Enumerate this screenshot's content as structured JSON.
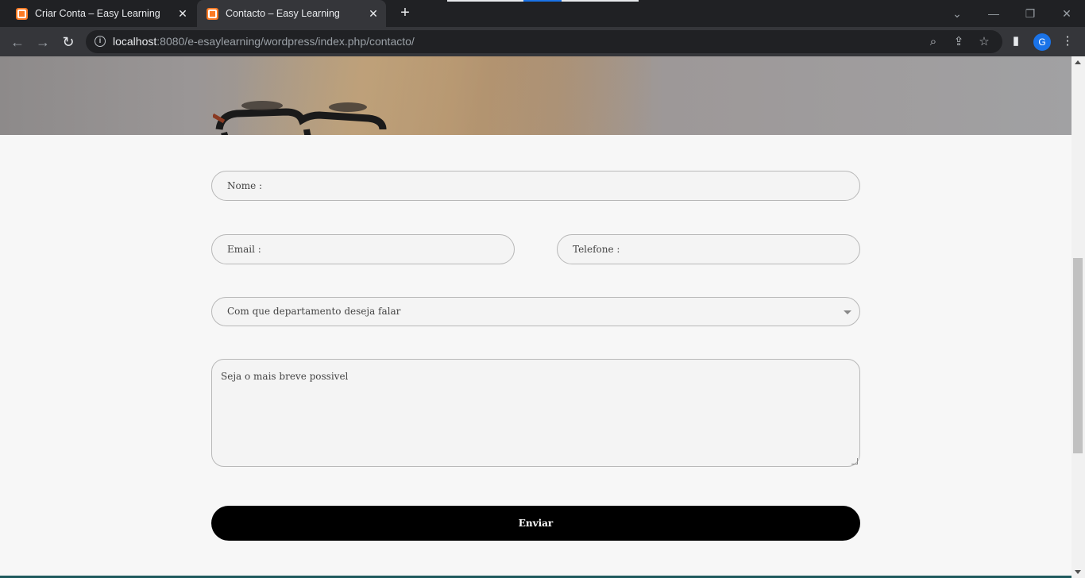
{
  "browser": {
    "tabs": [
      {
        "title": "Criar Conta – Easy Learning",
        "active": false,
        "favicon": "xampp-icon"
      },
      {
        "title": "Contacto – Easy Learning",
        "active": true,
        "favicon": "xampp-icon"
      }
    ],
    "new_tab_icon": "plus-icon",
    "url_host": "localhost",
    "url_rest": ":8080/e-esaylearning/wordpress/index.php/contacto/",
    "profile_initial": "G",
    "colors": {
      "frame": "#202124",
      "toolbar": "#35363a",
      "profile": "#1a73e8"
    }
  },
  "form": {
    "name_placeholder": "Nome :",
    "email_placeholder": "Email :",
    "phone_placeholder": "Telefone :",
    "department_selected": "Com que departamento deseja falar",
    "message_placeholder": "Seja o mais breve possivel",
    "submit_label": "Enviar"
  },
  "colors": {
    "page_bg": "#f7f7f7",
    "button_bg": "#000000",
    "field_bg": "#f4f4f4",
    "footer_accent": "#1f5a5e"
  }
}
